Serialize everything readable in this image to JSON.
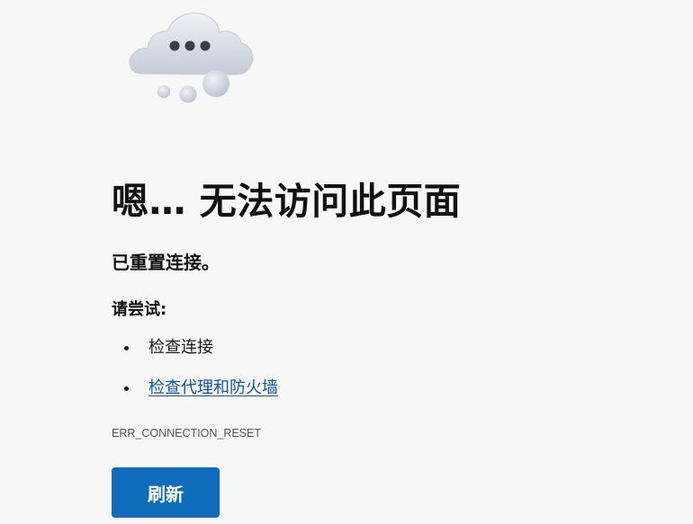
{
  "illustration": {
    "icon": "cloud-icon",
    "description_colors": {
      "cloud": "#dfe4eb",
      "cloud_shadow": "#b9c2ce",
      "dots": "#3a3d42"
    }
  },
  "error": {
    "title": "嗯… 无法访问此页面",
    "message": "已重置连接。",
    "try_heading": "请尝试:",
    "suggestions": [
      {
        "label": "检查连接",
        "link": false
      },
      {
        "label": "检查代理和防火墙",
        "link": true
      }
    ],
    "code": "ERR_CONNECTION_RESET"
  },
  "actions": {
    "refresh_label": "刷新"
  },
  "colors": {
    "background": "#f7f7f7",
    "link": "#0b57a4",
    "button": "#0f6cbd",
    "button_text": "#ffffff"
  }
}
